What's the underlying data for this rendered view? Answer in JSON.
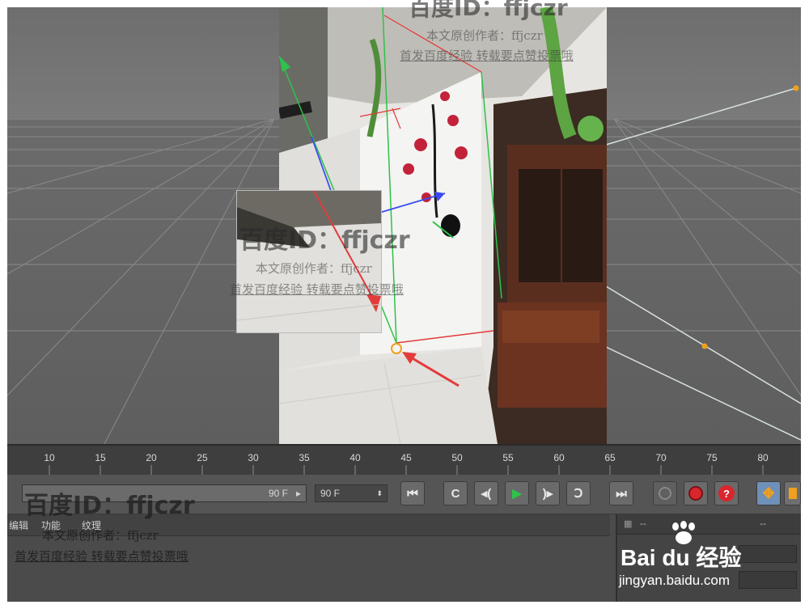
{
  "timeline": {
    "ticks": [
      "10",
      "15",
      "20",
      "25",
      "30",
      "35",
      "40",
      "45",
      "50",
      "55",
      "60",
      "65",
      "70",
      "75",
      "80"
    ]
  },
  "transport": {
    "end_frame_slider_value": "90 F",
    "end_frame_field_value": "90 F",
    "buttons": {
      "go_start": "⏮",
      "prev_key": "C",
      "prev_frame": "◂(",
      "play": "▶",
      "next_frame": ")▸",
      "next_key": "Ↄ",
      "go_end": "⏭",
      "help": "?"
    }
  },
  "bottom_panel": {
    "tabs": [
      "编辑",
      "功能",
      "纹理"
    ],
    "right_header": "--",
    "right_header_2": "--"
  },
  "watermarks": {
    "id_line": "百度ID：ffjczr",
    "author_line": "本文原创作者：ffjczr",
    "promo_line": "首发百度经验 转载要点赞投票哦"
  },
  "logo": {
    "brand": "Bai du 经验",
    "url": "jingyan.baidu.com"
  },
  "colors": {
    "accent_green": "#2ec24a",
    "accent_red": "#e23b3b",
    "accent_blue": "#3a4cf0",
    "accent_orange": "#f0a01e"
  }
}
